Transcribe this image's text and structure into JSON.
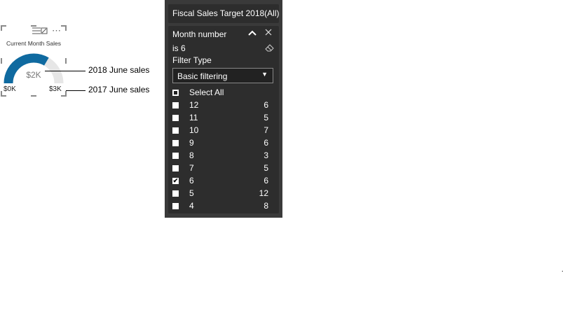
{
  "gauge": {
    "title": "Current Month Sales",
    "value_label": "$2K",
    "min_label": "$0K",
    "max_label": "$3K",
    "value_fraction": 0.67,
    "fill_color": "#0f6aa0",
    "track_color": "#e6e6e6",
    "more_icon": "ellipsis-icon",
    "focus_icon": "focus-mode-icon"
  },
  "annotations": {
    "value_note": "2018 June sales",
    "max_note": "2017 June sales"
  },
  "filter_pane": {
    "sales_target_card": "Fiscal Sales Target 2018(All)",
    "month_card": {
      "title": "Month number",
      "condition": "is 6",
      "filter_type_label": "Filter Type",
      "filter_type_value": "Basic filtering",
      "select_all_label": "Select All",
      "rows": [
        {
          "label": "12",
          "count": "6",
          "checked": false
        },
        {
          "label": "11",
          "count": "5",
          "checked": false
        },
        {
          "label": "10",
          "count": "7",
          "checked": false
        },
        {
          "label": "9",
          "count": "6",
          "checked": false
        },
        {
          "label": "8",
          "count": "3",
          "checked": false
        },
        {
          "label": "7",
          "count": "5",
          "checked": false
        },
        {
          "label": "6",
          "count": "6",
          "checked": true
        },
        {
          "label": "5",
          "count": "12",
          "checked": false
        },
        {
          "label": "4",
          "count": "8",
          "checked": false
        }
      ]
    }
  },
  "stray_mark": "."
}
